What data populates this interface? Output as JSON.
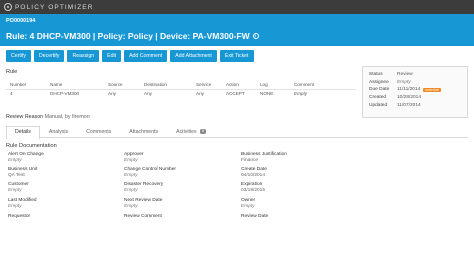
{
  "app": {
    "logo_text": "POLICY OPTIMIZER"
  },
  "header": {
    "policy_id": "PO0000194",
    "title": "Rule: 4 DHCP-VM300 | Policy: Policy | Device: PA-VM300-FW"
  },
  "toolbar": {
    "buttons": [
      "Certify",
      "Decertify",
      "Reassign",
      "Edit",
      "Add Comment",
      "Add Attachment",
      "Exit Ticket"
    ]
  },
  "rule": {
    "section_title": "Rule",
    "columns": [
      "Number",
      "Name",
      "Source",
      "Destination",
      "Service",
      "Action",
      "Log",
      "Comment"
    ],
    "rows": [
      [
        "4",
        "DHCP-VM300",
        "Any",
        "Any",
        "Any",
        "ACCEPT",
        "NONE",
        "Empty"
      ]
    ]
  },
  "status": {
    "status_label": "Status",
    "status_value": "Review",
    "assignee_label": "Assignee",
    "assignee_value": "Empty",
    "due_label": "Due Date",
    "due_value": "11/11/2014",
    "due_badge": "overdue",
    "created_label": "Created",
    "created_value": "10/28/2014",
    "updated_label": "Updated",
    "updated_value": "11/07/2014"
  },
  "review_reason": {
    "label": "Review Reason",
    "value": "Manual, by firemon"
  },
  "tabs": [
    {
      "label": "Details"
    },
    {
      "label": "Analysis"
    },
    {
      "label": "Comments"
    },
    {
      "label": "Attachments"
    },
    {
      "label": "Activities",
      "badge": "8"
    }
  ],
  "documentation": {
    "title": "Rule Documentation",
    "col1": [
      {
        "label": "Alert On Change",
        "value": "Empty"
      },
      {
        "label": "Business Unit",
        "value": "QA Test"
      },
      {
        "label": "Customer",
        "value": "Empty"
      },
      {
        "label": "Last Modified",
        "value": "Empty"
      },
      {
        "label": "Requestor",
        "value": ""
      }
    ],
    "col2": [
      {
        "label": "Approver",
        "value": "Empty"
      },
      {
        "label": "Change Control Number",
        "value": "Empty"
      },
      {
        "label": "Disaster Recovery",
        "value": "Empty"
      },
      {
        "label": "Next Review Date",
        "value": "Empty"
      },
      {
        "label": "Review Comment",
        "value": ""
      }
    ],
    "col3": [
      {
        "label": "Business Justification",
        "value": "Finance"
      },
      {
        "label": "Create Date",
        "value": "04/10/2014"
      },
      {
        "label": "Expiration",
        "value": "03/19/2015"
      },
      {
        "label": "Owner",
        "value": "Empty"
      },
      {
        "label": "Review Date",
        "value": ""
      }
    ]
  }
}
